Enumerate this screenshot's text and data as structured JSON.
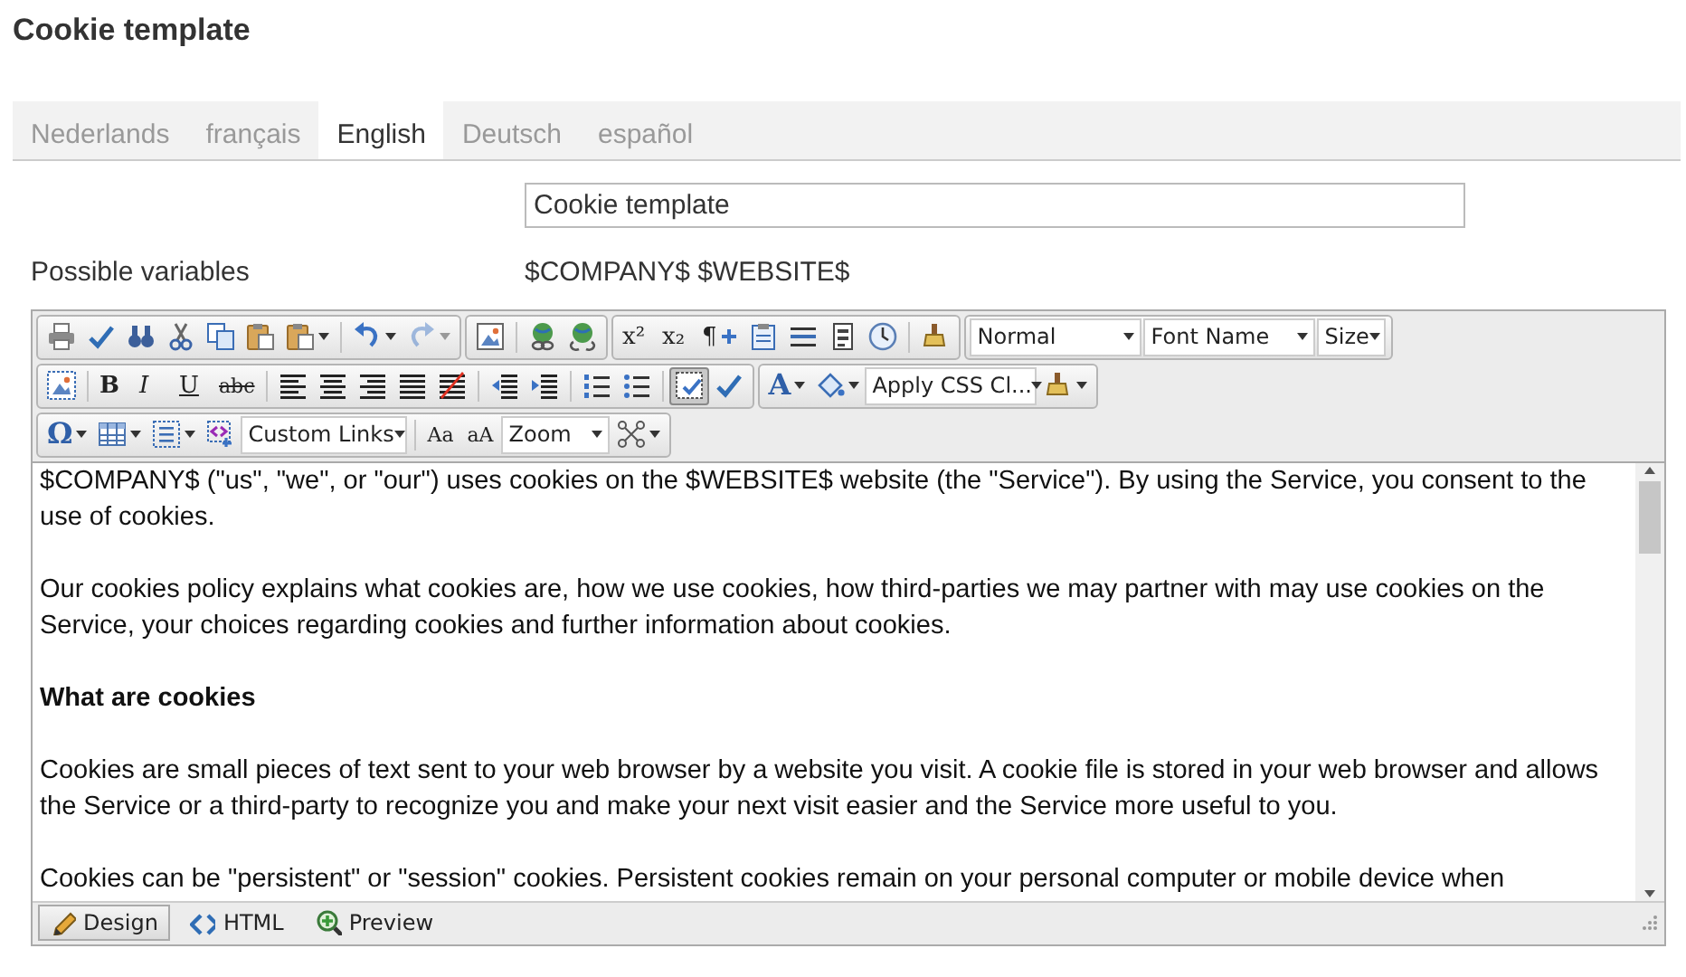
{
  "page_title": "Cookie template",
  "language_tabs": [
    {
      "label": "Nederlands",
      "selected": false
    },
    {
      "label": "français",
      "selected": false
    },
    {
      "label": "English",
      "selected": true
    },
    {
      "label": "Deutsch",
      "selected": false
    },
    {
      "label": "español",
      "selected": false
    }
  ],
  "title_field": {
    "value": "Cookie template"
  },
  "variables": {
    "label": "Possible variables",
    "value": "$COMPANY$ $WEBSITE$"
  },
  "toolbar_rows": [
    [
      [
        {
          "kind": "print"
        },
        {
          "kind": "spell"
        },
        {
          "kind": "find"
        },
        {
          "kind": "cut"
        },
        {
          "kind": "copy"
        },
        {
          "kind": "paste"
        },
        {
          "kind": "paste",
          "menu": true
        },
        {
          "kind": "sep"
        },
        {
          "kind": "undo",
          "menu": true
        },
        {
          "kind": "redo",
          "menu": true,
          "disabled": true
        }
      ],
      [
        {
          "kind": "image"
        },
        {
          "kind": "sep"
        },
        {
          "kind": "link"
        },
        {
          "kind": "unlink"
        }
      ],
      [
        {
          "kind": "text",
          "label": "x²"
        },
        {
          "kind": "text",
          "label": "x₂"
        },
        {
          "kind": "para",
          "label": "¶"
        },
        {
          "kind": "template"
        },
        {
          "kind": "rule"
        },
        {
          "kind": "form"
        },
        {
          "kind": "clock"
        },
        {
          "kind": "sep"
        },
        {
          "kind": "brush"
        }
      ],
      [
        {
          "kind": "dropdown",
          "value": "Normal"
        },
        {
          "kind": "dropdown",
          "value": "Font Name"
        },
        {
          "kind": "dropdown",
          "value": "Size"
        }
      ]
    ],
    [
      [
        {
          "kind": "imagemap"
        },
        {
          "kind": "sep"
        },
        {
          "kind": "bold",
          "label": "B"
        },
        {
          "kind": "italic",
          "label": "I"
        },
        {
          "kind": "underline",
          "label": "U"
        },
        {
          "kind": "strike",
          "label": "abc"
        },
        {
          "kind": "sep"
        },
        {
          "kind": "alignleft"
        },
        {
          "kind": "aligncenter"
        },
        {
          "kind": "alignright"
        },
        {
          "kind": "alignjustify"
        },
        {
          "kind": "alignnone"
        },
        {
          "kind": "sep"
        },
        {
          "kind": "outdent"
        },
        {
          "kind": "indent"
        },
        {
          "kind": "sep"
        },
        {
          "kind": "olist"
        },
        {
          "kind": "ulist"
        },
        {
          "kind": "sep"
        },
        {
          "kind": "border",
          "selected": true
        },
        {
          "kind": "spell",
          "selected": false
        }
      ],
      [
        {
          "kind": "letter",
          "label": "A",
          "menu": true
        },
        {
          "kind": "bucket",
          "menu": true
        },
        {
          "kind": "dropdown",
          "value": "Apply CSS Cl..."
        },
        {
          "kind": "brush",
          "menu": true
        }
      ]
    ],
    [
      [
        {
          "kind": "letter",
          "label": "Ω",
          "menu": true
        },
        {
          "kind": "table",
          "menu": true
        },
        {
          "kind": "list",
          "menu": true
        },
        {
          "kind": "customlink"
        },
        {
          "kind": "dropdown",
          "value": "Custom Links"
        },
        {
          "kind": "sep"
        },
        {
          "kind": "case",
          "label": "Aa"
        },
        {
          "kind": "case",
          "label": "aA"
        },
        {
          "kind": "dropdown",
          "value": "Zoom"
        },
        {
          "kind": "network",
          "menu": true
        }
      ]
    ]
  ],
  "content": [
    {
      "kind": "paragraph",
      "text": "$COMPANY$ (\"us\", \"we\", or \"our\") uses cookies on the $WEBSITE$ website (the \"Service\"). By using the Service, you consent to the use of cookies."
    },
    {
      "kind": "paragraph",
      "text": "Our cookies policy explains what cookies are, how we use cookies, how third-parties we may partner with may use cookies on the Service, your choices regarding cookies and further information about cookies."
    },
    {
      "kind": "heading",
      "text": "What are cookies"
    },
    {
      "kind": "paragraph",
      "text": "Cookies are small pieces of text sent to your web browser by a website you visit. A cookie file is stored in your web browser and allows the Service or a third-party to recognize you and make your next visit easier and the Service more useful to you."
    },
    {
      "kind": "paragraph",
      "text": "Cookies can be \"persistent\" or \"session\" cookies. Persistent cookies remain on your personal computer or mobile device when"
    }
  ],
  "modes": [
    {
      "label": "Design",
      "kind": "design",
      "selected": true
    },
    {
      "label": "HTML",
      "kind": "html",
      "selected": false
    },
    {
      "label": "Preview",
      "kind": "preview",
      "selected": false
    }
  ]
}
